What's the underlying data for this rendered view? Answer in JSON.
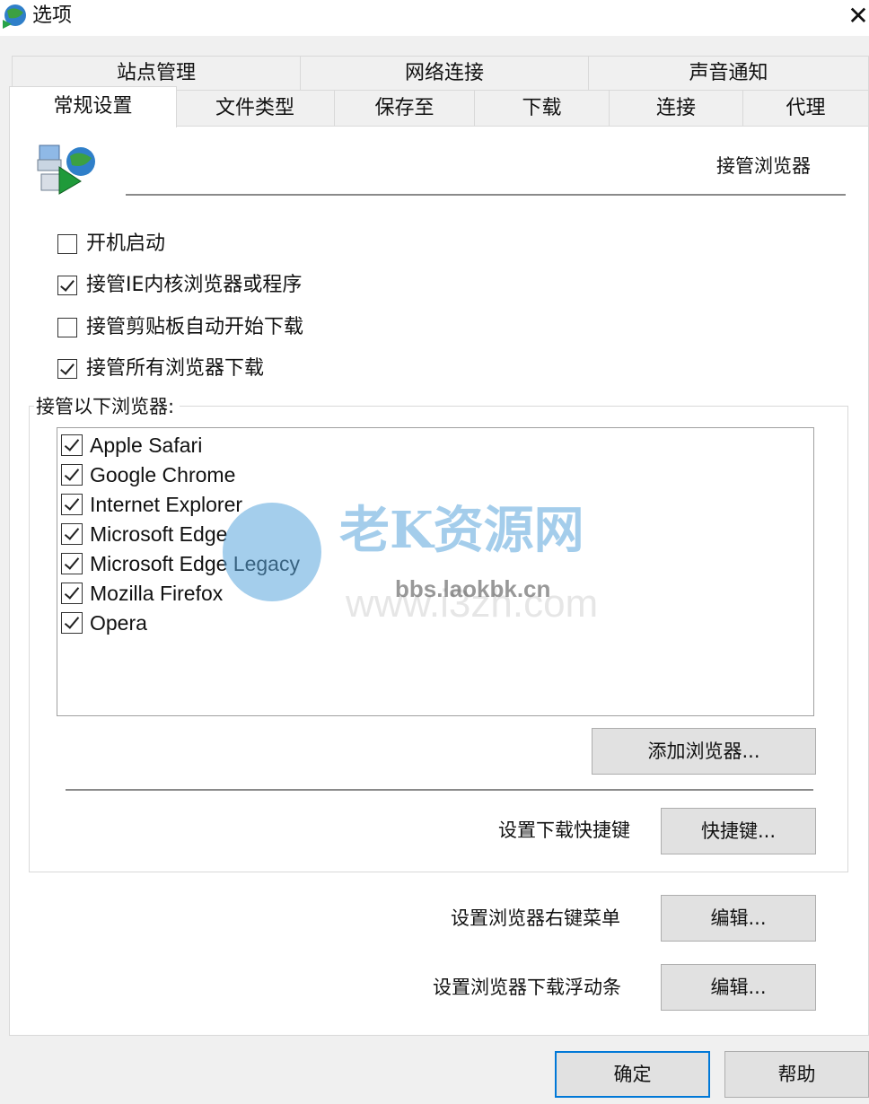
{
  "window": {
    "title": "选项",
    "close_glyph": "✕"
  },
  "tabs_back": [
    "站点管理",
    "网络连接",
    "声音通知"
  ],
  "tabs_front": [
    "常规设置",
    "文件类型",
    "保存至",
    "下载",
    "连接",
    "代理"
  ],
  "active_tab": "常规设置",
  "section": {
    "icon": "idm-app-icon",
    "title": "接管浏览器"
  },
  "options": [
    {
      "label": "开机启动",
      "checked": false
    },
    {
      "label": "接管IE内核浏览器或程序",
      "checked": true
    },
    {
      "label": "接管剪贴板自动开始下载",
      "checked": false
    },
    {
      "label": "接管所有浏览器下载",
      "checked": true
    }
  ],
  "browsers_group": {
    "legend": "接管以下浏览器:",
    "browsers": [
      {
        "label": "Apple Safari",
        "checked": true
      },
      {
        "label": "Google Chrome",
        "checked": true
      },
      {
        "label": "Internet Explorer",
        "checked": true
      },
      {
        "label": "Microsoft Edge",
        "checked": true
      },
      {
        "label": "Microsoft Edge Legacy",
        "checked": true
      },
      {
        "label": "Mozilla Firefox",
        "checked": true
      },
      {
        "label": "Opera",
        "checked": true
      }
    ],
    "add_button": "添加浏览器...",
    "hotkey_label": "设置下载快捷键",
    "hotkey_button": "快捷键..."
  },
  "context_menu": {
    "label": "设置浏览器右键菜单",
    "button": "编辑..."
  },
  "float_bar": {
    "label": "设置浏览器下载浮动条",
    "button": "编辑..."
  },
  "footer": {
    "ok": "确定",
    "help": "帮助"
  },
  "watermark": {
    "main": "老K资源网",
    "sub": "bbs.laokbk.cn",
    "faint": "www.i3zh.com"
  },
  "colors": {
    "accent": "#0078d7",
    "watermark": "#5aa6dc"
  }
}
